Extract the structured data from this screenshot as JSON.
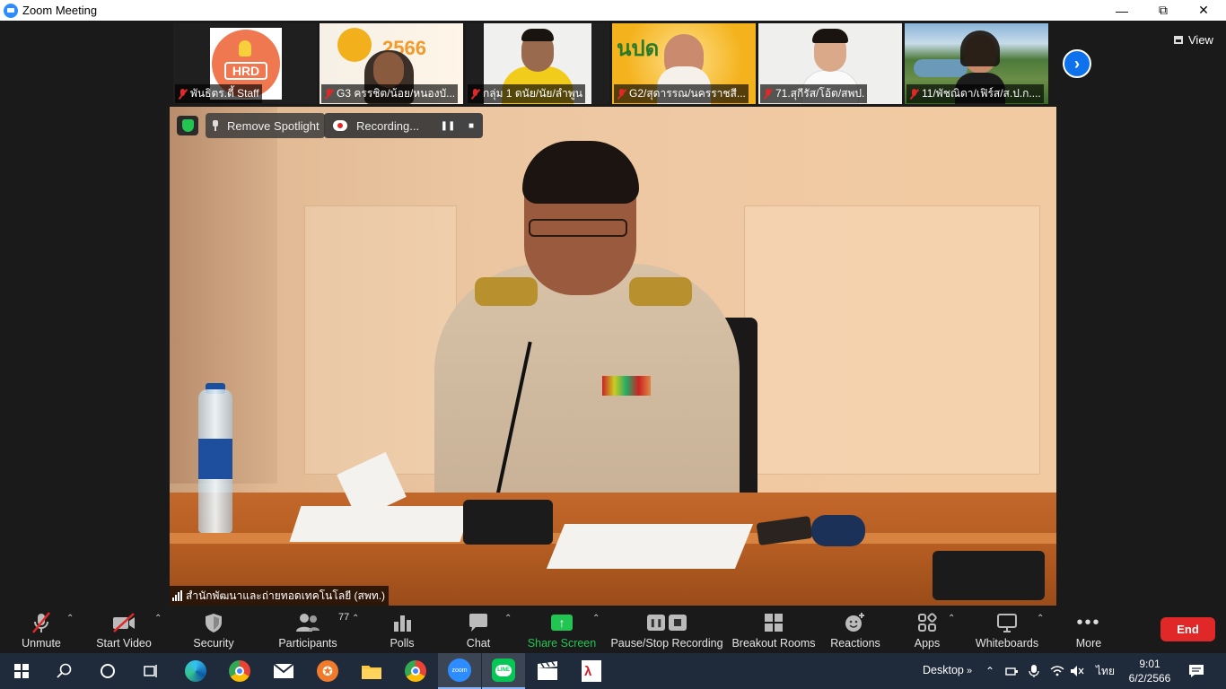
{
  "window": {
    "title": "Zoom Meeting"
  },
  "thumbnails": [
    {
      "name": "พันธิตร.ตี้ Staff"
    },
    {
      "name": "G3 ครรชิต/น้อย/หนองบั..."
    },
    {
      "name": "กลุ่ม 1 ดนัย/นัย/ลำพูน"
    },
    {
      "name": "G2/สุดารรณ/นครราชสี..."
    },
    {
      "name": "71.สุกีรัส/โอ้ต/สพป."
    },
    {
      "name": "11/พัชณิดา/เฟิร์ส/ส.ป.ก...."
    }
  ],
  "view_button": {
    "label": "View"
  },
  "main_video": {
    "spotlight_label": "Remove Spotlight",
    "recording_label": "Recording...",
    "participant_name": "สำนักพัฒนาและถ่ายทอดเทคโนโลยี (สพท.)"
  },
  "toolbar": {
    "unmute": "Unmute",
    "start_video": "Start Video",
    "security": "Security",
    "participants": "Participants",
    "participants_count": "77",
    "polls": "Polls",
    "chat": "Chat",
    "share_screen": "Share Screen",
    "pause_stop_recording": "Pause/Stop Recording",
    "breakout_rooms": "Breakout Rooms",
    "reactions": "Reactions",
    "apps": "Apps",
    "whiteboards": "Whiteboards",
    "more": "More",
    "end": "End"
  },
  "taskbar": {
    "desktop_label": "Desktop",
    "language": "ไทย",
    "time": "9:01",
    "date": "6/2/2566"
  },
  "colors": {
    "accent_blue": "#0E72ED",
    "end_red": "#E02828",
    "share_green": "#23C552"
  }
}
